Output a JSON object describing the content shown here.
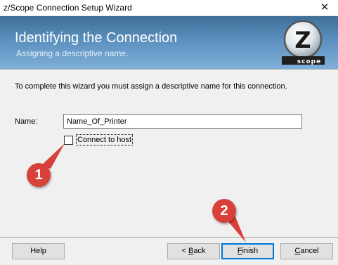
{
  "window": {
    "title": "z/Scope Connection Setup Wizard",
    "close_glyph": "✕"
  },
  "header": {
    "title": "Identifying the Connection",
    "subtitle": "Assigning a descriptive name.",
    "logo": {
      "letter": "Z",
      "word": "scope"
    }
  },
  "body": {
    "intro": "To complete this wizard you must assign a descriptive name for this connection.",
    "name_label": "Name:",
    "name_value": "Name_Of_Printer",
    "connect_checkbox": {
      "label": "Connect to host",
      "checked": false
    }
  },
  "buttons": {
    "help": "Help",
    "back_glyph": "< ",
    "back_key": "B",
    "back_rest": "ack",
    "finish_key": "F",
    "finish_rest": "inish",
    "cancel_key": "C",
    "cancel_rest": "ancel"
  },
  "annotations": [
    {
      "number": "1"
    },
    {
      "number": "2"
    }
  ],
  "colors": {
    "header_top": "#3f6f98",
    "header_bottom": "#7fb0da",
    "annotation": "#d8403a",
    "focus": "#0078d7"
  }
}
